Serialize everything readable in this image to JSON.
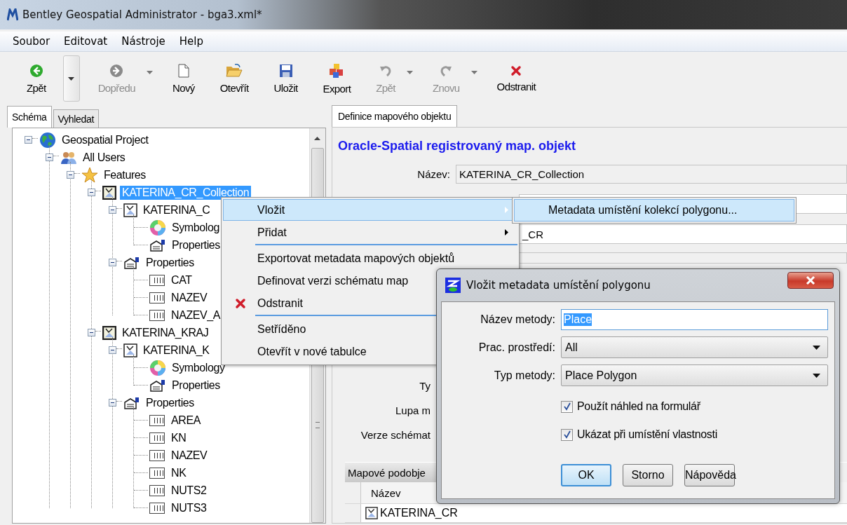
{
  "window": {
    "title": "Bentley Geospatial Administrator - bga3.xml*"
  },
  "menu": [
    "Soubor",
    "Editovat",
    "Nástroje",
    "Help"
  ],
  "toolbar": [
    {
      "label": "Zpět",
      "kind": "back",
      "disabled": false,
      "dropdown": true
    },
    {
      "label": "Dopředu",
      "kind": "forward",
      "disabled": true,
      "dropdown": true
    },
    {
      "label": "Nový",
      "kind": "new",
      "disabled": false
    },
    {
      "label": "Otevřít",
      "kind": "open",
      "disabled": false
    },
    {
      "label": "Uložit",
      "kind": "save",
      "disabled": false
    },
    {
      "label": "Export",
      "kind": "export",
      "disabled": false
    },
    {
      "label": "Zpět",
      "kind": "undo",
      "disabled": true,
      "dropdown": true
    },
    {
      "label": "Znovu",
      "kind": "redo",
      "disabled": true,
      "dropdown": true
    },
    {
      "label": "Odstranit",
      "kind": "delete",
      "disabled": false
    }
  ],
  "left_tabs": [
    {
      "label": "Schéma",
      "selected": true
    },
    {
      "label": "Vyhledat",
      "selected": false
    }
  ],
  "tree": [
    {
      "label": "Geospatial Project",
      "kind": "project",
      "selected": false,
      "expanded": true,
      "children": [
        {
          "label": "All Users",
          "kind": "users",
          "selected": false,
          "expanded": true,
          "children": [
            {
              "label": "Features",
              "kind": "features",
              "selected": false,
              "expanded": true,
              "children": [
                {
                  "label": "KATERINA_CR_Collection",
                  "kind": "collection",
                  "selected": true,
                  "expanded": true,
                  "children": [
                    {
                      "label": "KATERINA_C",
                      "kind": "feature",
                      "selected": false,
                      "expanded": true,
                      "children": [
                        {
                          "label": "Symbolog",
                          "kind": "symbology",
                          "selected": false
                        },
                        {
                          "label": "Properties",
                          "kind": "properties",
                          "selected": false
                        }
                      ]
                    },
                    {
                      "label": "Properties",
                      "kind": "properties",
                      "selected": false,
                      "expanded": true,
                      "children": [
                        {
                          "label": "CAT",
                          "kind": "attribute",
                          "selected": false
                        },
                        {
                          "label": "NAZEV",
                          "kind": "attribute",
                          "selected": false
                        },
                        {
                          "label": "NAZEV_A",
                          "kind": "attribute",
                          "selected": false
                        }
                      ]
                    }
                  ]
                },
                {
                  "label": "KATERINA_KRAJ",
                  "kind": "collection",
                  "selected": false,
                  "expanded": true,
                  "children": [
                    {
                      "label": "KATERINA_K",
                      "kind": "feature",
                      "selected": false,
                      "expanded": true,
                      "children": [
                        {
                          "label": "Symbology",
                          "kind": "symbology",
                          "selected": false
                        },
                        {
                          "label": "Properties",
                          "kind": "properties",
                          "selected": false
                        }
                      ]
                    },
                    {
                      "label": "Properties",
                      "kind": "properties",
                      "selected": false,
                      "expanded": true,
                      "children": [
                        {
                          "label": "AREA",
                          "kind": "attribute",
                          "selected": false
                        },
                        {
                          "label": "KN",
                          "kind": "attribute",
                          "selected": false
                        },
                        {
                          "label": "NAZEV",
                          "kind": "attribute",
                          "selected": false
                        },
                        {
                          "label": "NK",
                          "kind": "attribute",
                          "selected": false
                        },
                        {
                          "label": "NUTS2",
                          "kind": "attribute",
                          "selected": false
                        },
                        {
                          "label": "NUTS3",
                          "kind": "attribute",
                          "selected": false
                        }
                      ]
                    }
                  ]
                }
              ]
            }
          ]
        }
      ]
    }
  ],
  "right_tabs": [
    {
      "label": "Definice mapového objektu",
      "selected": true
    }
  ],
  "form": {
    "heading": "Oracle-Spatial registrovaný map. objekt",
    "name_label": "Název:",
    "name_value": "KATERINA_CR_Collection",
    "row_3_value": "_CR",
    "labels": [
      "Ty",
      "Lupa m",
      "Verze schémat"
    ]
  },
  "subobjects": {
    "title": "Mapové podobje",
    "columns": [
      "Název"
    ],
    "rows": [
      "KATERINA_CR"
    ]
  },
  "context_menu": [
    {
      "kind": "item",
      "label": "Vložit",
      "selected": true,
      "submenu": true
    },
    {
      "kind": "item",
      "label": "Přidat",
      "selected": false,
      "submenu": true
    },
    {
      "kind": "separator"
    },
    {
      "kind": "item",
      "label": "Exportovat metadata mapových objektů",
      "selected": false
    },
    {
      "kind": "item",
      "label": "Definovat verzi schématu map",
      "selected": false
    },
    {
      "kind": "delete",
      "label": "Odstranit",
      "selected": false
    },
    {
      "kind": "separator"
    },
    {
      "kind": "item",
      "label": "Setříděno",
      "selected": false
    },
    {
      "kind": "item",
      "label": "Otevřít v nové tabulce",
      "selected": false
    }
  ],
  "submenu": [
    {
      "label": "Metadata umístění kolekcí polygonu...",
      "selected": true
    }
  ],
  "dialog": {
    "title": "Vložit metadata umístění polygonu",
    "fields": [
      {
        "kind": "text",
        "label": "Název metody:",
        "value": "Place",
        "selected": true
      },
      {
        "kind": "select",
        "label": "Prac. prostředí:",
        "value": "All"
      },
      {
        "kind": "select",
        "label": "Typ metody:",
        "value": "Place Polygon"
      }
    ],
    "checkboxes": [
      {
        "label": "Použít náhled na formulář",
        "checked": true
      },
      {
        "label": "Ukázat při umístění vlastnosti",
        "checked": true
      }
    ],
    "buttons": [
      {
        "label": "OK",
        "default": true
      },
      {
        "label": "Storno",
        "default": false
      },
      {
        "label": "Nápověda",
        "default": false
      }
    ]
  }
}
